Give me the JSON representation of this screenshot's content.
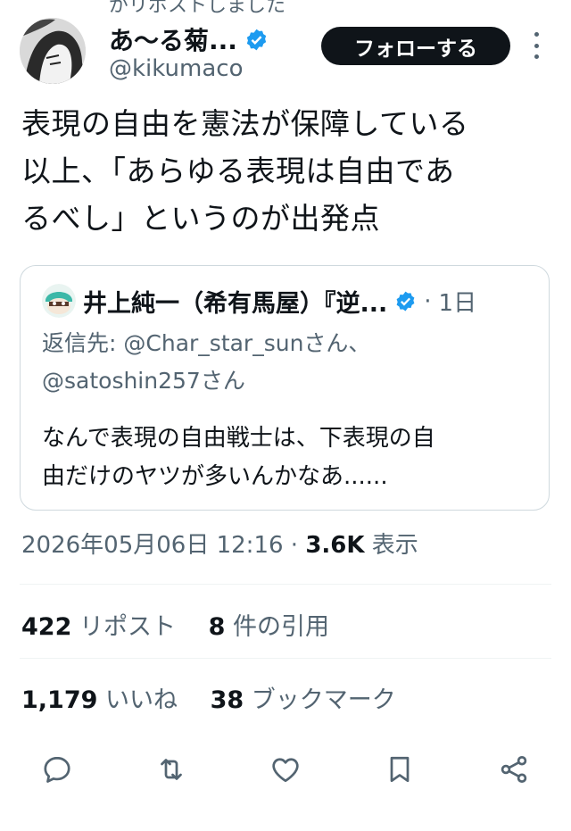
{
  "header": {
    "reposted_text": "がリポストしました"
  },
  "author": {
    "name": "あ〜る菊...",
    "handle": "@kikumaco",
    "verified": true
  },
  "follow_button_label": "フォローする",
  "more_icon": "more-vertical-icon",
  "tweet_text": "表現の自由を憲法が保障している\n以上、「あらゆる表現は自由であ\nるべし」というのが出発点",
  "quote": {
    "author_name": "井上純一（希有馬屋）『逆...",
    "verified": true,
    "dot": "·",
    "time": "1日",
    "reply_prefix": "返信先:",
    "reply_to_1": "@Char_star_sunさん、",
    "reply_to_2": "@satoshin257さん",
    "text": "なんで表現の自由戦士は、下表現の自\n由だけのヤツが多いんかなあ......"
  },
  "meta": {
    "datetime": "2026年05月06日 12:16 · ",
    "views_count": "3.6K",
    "views_label": " 表示"
  },
  "stats": {
    "reposts_count": "422",
    "reposts_label": "リポスト",
    "quotes_count": "8",
    "quotes_label": "件の引用",
    "likes_count": "1,179",
    "likes_label": "いいね",
    "bookmarks_count": "38",
    "bookmarks_label": "ブックマーク"
  },
  "actions": [
    "reply-icon",
    "repost-icon",
    "like-icon",
    "bookmark-icon",
    "share-icon"
  ],
  "colors": {
    "verified_blue": "#1d9bf0",
    "text": "#0f1419",
    "muted": "#536471",
    "border": "#cfd9de"
  }
}
